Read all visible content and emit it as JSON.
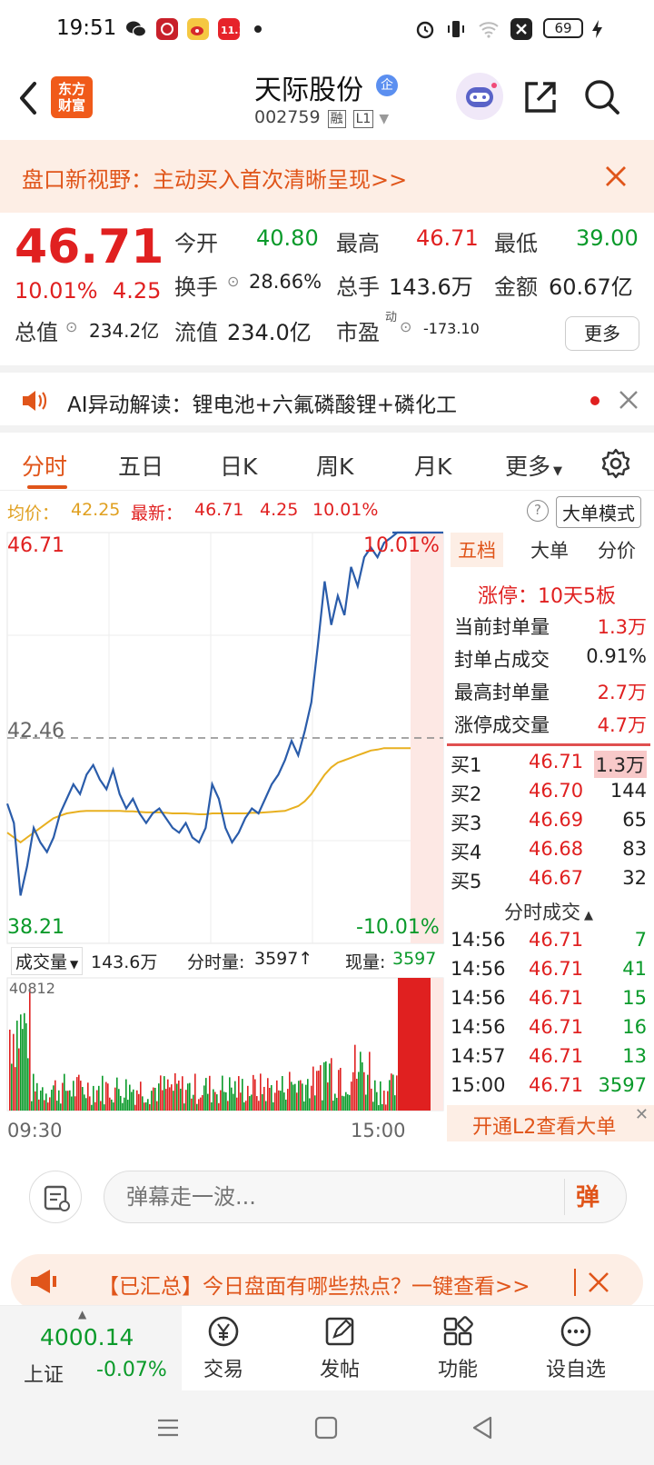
{
  "status_bar": {
    "time": "19:51",
    "battery": "69",
    "icons": [
      "wechat-icon",
      "app-icon",
      "weibo-icon",
      "shopping-icon",
      "dot-icon",
      "alarm-icon",
      "vibrate-icon",
      "wifi-icon",
      "sim-icon",
      "battery-icon",
      "charging-icon"
    ]
  },
  "header": {
    "logo_line1": "东方",
    "logo_line2": "财富",
    "stock_name": "天际股份",
    "badge": "企",
    "stock_code": "002759",
    "tag_rong": "融",
    "tag_level": "L1"
  },
  "banner": {
    "text": "盘口新视野：主动买入首次清晰呈现>>"
  },
  "quote": {
    "price": "46.71",
    "change_pct": "10.01%",
    "change_amt": "4.25",
    "open_label": "今开",
    "open_value": "40.80",
    "high_label": "最高",
    "high_value": "46.71",
    "low_label": "最低",
    "low_value": "39.00",
    "turnover_label": "换手",
    "turnover_value": "28.66%",
    "volume_label": "总手",
    "volume_value": "143.6万",
    "amount_label": "金额",
    "amount_value": "60.67亿",
    "mktcap_label": "总值",
    "mktcap_value": "234.2亿",
    "float_label": "流值",
    "float_value": "234.0亿",
    "pe_label": "市盈",
    "pe_sup": "动",
    "pe_value": "-173.10",
    "more_button": "更多"
  },
  "ai_bar": {
    "text": "AI异动解读：锂电池+六氟磷酸锂+磷化工"
  },
  "tabs": {
    "items": [
      "分时",
      "五日",
      "日K",
      "周K",
      "月K",
      "更多"
    ],
    "active": 0
  },
  "info_line": {
    "avg_label": "均价：",
    "avg_value": "42.25",
    "latest_label": "最新：",
    "latest_value": "46.71",
    "latest_change": "4.25",
    "latest_pct": "10.01%",
    "big_order_mode": "大单模式"
  },
  "chart_labels": {
    "y_top": "46.71",
    "y_mid": "42.46",
    "y_bottom": "38.21",
    "pct_top": "10.01%",
    "pct_bottom": "-10.01%",
    "volume_selector": "成交量",
    "volume_total": "143.6万",
    "tick_volume_label": "分时量:",
    "tick_volume_value": "3597",
    "current_label": "现量:",
    "current_value": "3597",
    "volume_max": "40812",
    "time_start": "09:30",
    "time_end": "15:00"
  },
  "chart_data": {
    "type": "line",
    "title": "",
    "y_range": [
      38.21,
      46.71
    ],
    "pre_close": 42.46,
    "series": [
      {
        "name": "price",
        "values": [
          41.1,
          40.7,
          39.2,
          39.8,
          40.6,
          40.3,
          40.1,
          40.4,
          40.9,
          41.2,
          41.5,
          41.3,
          41.7,
          41.9,
          41.6,
          41.4,
          41.8,
          41.3,
          41.0,
          41.2,
          40.9,
          40.7,
          40.9,
          41.0,
          40.8,
          40.6,
          40.5,
          40.7,
          40.4,
          40.3,
          40.6,
          41.5,
          41.2,
          40.6,
          40.3,
          40.5,
          40.8,
          41.0,
          40.9,
          41.2,
          41.5,
          41.7,
          42.0,
          42.4,
          42.1,
          42.6,
          43.2,
          44.4,
          45.7,
          44.8,
          45.4,
          45.0,
          46.0,
          45.6,
          46.2,
          46.4,
          46.2,
          46.5,
          46.6,
          46.71,
          46.71,
          46.71
        ]
      },
      {
        "name": "avg",
        "values": [
          40.5,
          40.4,
          40.3,
          40.4,
          40.5,
          40.6,
          40.7,
          40.8,
          40.85,
          40.9,
          40.92,
          40.94,
          40.95,
          40.95,
          40.95,
          40.95,
          40.95,
          40.95,
          40.94,
          40.94,
          40.93,
          40.92,
          40.92,
          40.92,
          40.91,
          40.9,
          40.9,
          40.9,
          40.89,
          40.88,
          40.88,
          40.9,
          40.9,
          40.9,
          40.9,
          40.9,
          40.9,
          40.91,
          40.91,
          40.92,
          40.93,
          40.94,
          40.95,
          41.0,
          41.05,
          41.15,
          41.3,
          41.5,
          41.7,
          41.85,
          41.95,
          42.0,
          42.05,
          42.1,
          42.15,
          42.2,
          42.22,
          42.25,
          42.25,
          42.25,
          42.25,
          42.25
        ]
      }
    ]
  },
  "right_panel": {
    "tabs": [
      "五档",
      "大单",
      "分价"
    ],
    "limit_title": "涨停：10天5板",
    "stats": [
      {
        "label": "当前封单量",
        "value": "1.3万"
      },
      {
        "label": "封单占成交",
        "value": "0.91%"
      },
      {
        "label": "最高封单量",
        "value": "2.7万"
      },
      {
        "label": "涨停成交量",
        "value": "4.7万"
      }
    ],
    "bids": [
      {
        "label": "买1",
        "price": "46.71",
        "qty": "1.3万"
      },
      {
        "label": "买2",
        "price": "46.70",
        "qty": "144"
      },
      {
        "label": "买3",
        "price": "46.69",
        "qty": "65"
      },
      {
        "label": "买4",
        "price": "46.68",
        "qty": "83"
      },
      {
        "label": "买5",
        "price": "46.67",
        "qty": "32"
      }
    ],
    "ticks_title": "分时成交",
    "ticks": [
      {
        "time": "14:56",
        "price": "46.71",
        "qty": "7"
      },
      {
        "time": "14:56",
        "price": "46.71",
        "qty": "41"
      },
      {
        "time": "14:56",
        "price": "46.71",
        "qty": "15"
      },
      {
        "time": "14:56",
        "price": "46.71",
        "qty": "16"
      },
      {
        "time": "14:57",
        "price": "46.71",
        "qty": "13"
      },
      {
        "time": "15:00",
        "price": "46.71",
        "qty": "3597"
      }
    ],
    "l2_promo": "开通L2查看大单"
  },
  "comment": {
    "placeholder": "弹幕走一波...",
    "danmu_button": "弹"
  },
  "promo": {
    "text": "【已汇总】今日盘面有哪些热点？一键查看>>"
  },
  "bottom_nav": {
    "index_value": "4000.14",
    "index_name": "上证",
    "index_change": "-0.07%",
    "items": [
      "交易",
      "发帖",
      "功能",
      "设自选"
    ]
  }
}
